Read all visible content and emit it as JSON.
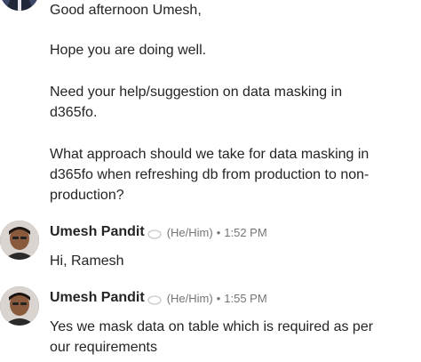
{
  "messages": [
    {
      "paragraphs": [
        "Good afternoon Umesh,",
        "Hope you are doing well.",
        "Need your help/suggestion on data masking in",
        "d365fo.",
        "What approach should we take for data masking in",
        "d365fo when refreshing db from production to non-",
        "production?"
      ]
    },
    {
      "sender": "Umesh Pandit",
      "pronouns": "(He/Him)",
      "separator": "•",
      "time": "1:52 PM",
      "text": "Hi, Ramesh"
    },
    {
      "sender": "Umesh Pandit",
      "pronouns": "(He/Him)",
      "separator": "•",
      "time": "1:55 PM",
      "lines": [
        "Yes we mask data on table which is required as per",
        "our requirements"
      ]
    }
  ],
  "icons": {
    "status": "status-ring-icon",
    "avatar_top": "avatar-partial",
    "avatar_umesh": "avatar-photo"
  }
}
